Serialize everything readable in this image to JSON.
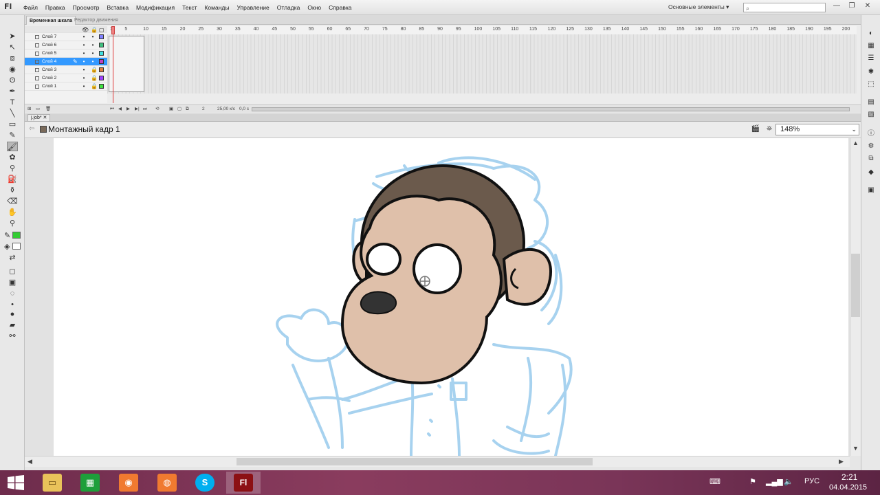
{
  "app": {
    "logo": "Fl",
    "menu": [
      "Файл",
      "Правка",
      "Просмотр",
      "Вставка",
      "Модификация",
      "Текст",
      "Команды",
      "Управление",
      "Отладка",
      "Окно",
      "Справка"
    ],
    "workspace": "Основные элементы",
    "workspace_arrow": "▾",
    "search_placeholder": "",
    "window_controls": {
      "minimize": "—",
      "restore": "❐",
      "close": "✕"
    }
  },
  "timeline": {
    "tabs": [
      "Временная шкала",
      "Редактор движения"
    ],
    "layers": [
      {
        "name": "Слой 7",
        "color": "#8080ff",
        "locked": false,
        "selected": false
      },
      {
        "name": "Слой 6",
        "color": "#40c080",
        "locked": false,
        "selected": false
      },
      {
        "name": "Слой 5",
        "color": "#40e0e0",
        "locked": false,
        "selected": false
      },
      {
        "name": "Слой 4",
        "color": "#c040c0",
        "locked": false,
        "selected": true
      },
      {
        "name": "Слой 3",
        "color": "#e08040",
        "locked": true,
        "selected": false
      },
      {
        "name": "Слой 2",
        "color": "#a040ff",
        "locked": true,
        "selected": false
      },
      {
        "name": "Слой 1",
        "color": "#40e040",
        "locked": true,
        "selected": false
      }
    ],
    "ruler_labels": [
      "1",
      "5",
      "10",
      "15",
      "20",
      "25",
      "30",
      "35",
      "40",
      "45",
      "50",
      "55",
      "60",
      "65",
      "70",
      "75",
      "80",
      "85",
      "90",
      "95",
      "100",
      "105",
      "110",
      "115",
      "120",
      "125",
      "130",
      "135",
      "140",
      "145",
      "150",
      "155",
      "160",
      "165",
      "170",
      "175",
      "180",
      "185",
      "190",
      "195",
      "200"
    ],
    "current_frame": "2",
    "fps": "25,00 к/с",
    "time": "0,0 с"
  },
  "document": {
    "tab_name": "j.job*",
    "scene_name": "Монтажный кадр 1",
    "zoom": "148%"
  },
  "taskbar": {
    "language": "РУС",
    "time": "2:21",
    "date": "04.04.2015",
    "apps": [
      "file-explorer",
      "store",
      "app-orange-1",
      "app-orange-2",
      "skype",
      "flash"
    ]
  },
  "colors": {
    "stroke_color": "#222222",
    "fill_color": "#33cc33",
    "sketch_blue": "#a7d2ef",
    "monkey_skin": "#dfc0aa",
    "monkey_fur": "#6b5a4c",
    "selection": "#3399ff"
  }
}
